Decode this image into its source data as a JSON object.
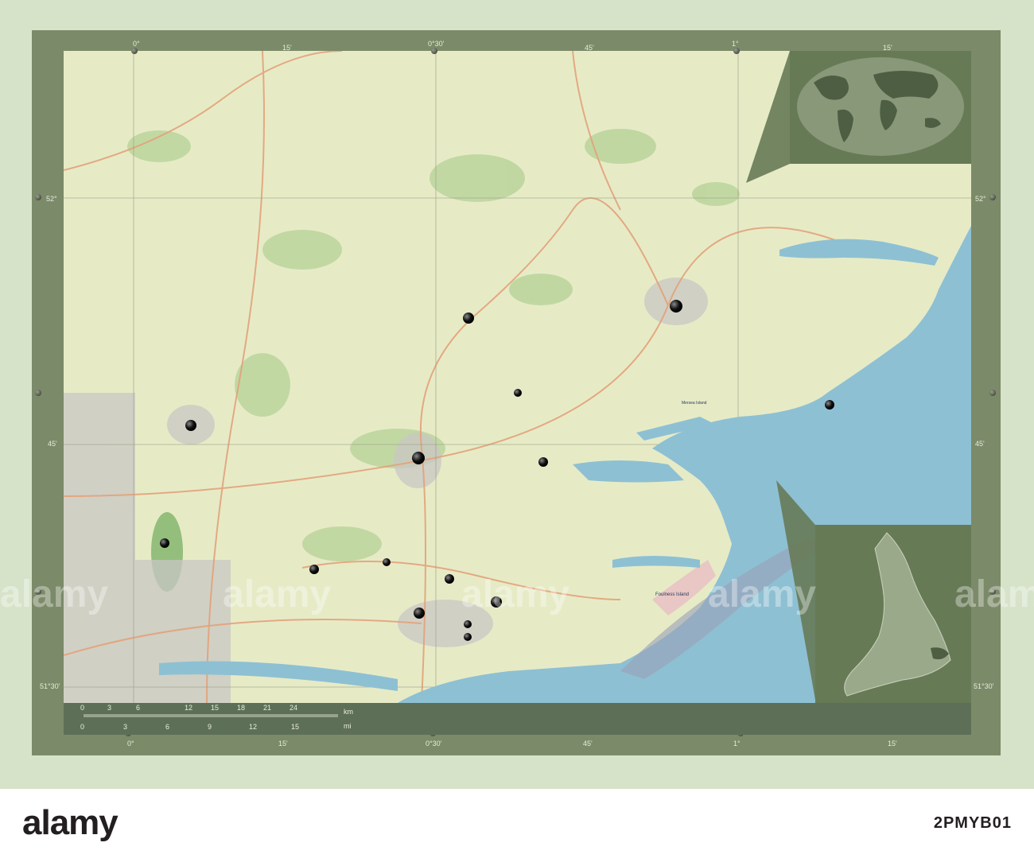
{
  "map": {
    "lon_labels_top": [
      "0°",
      "15'",
      "0°30'",
      "45'",
      "1°",
      "15'"
    ],
    "lon_labels_bottom": [
      "0°",
      "15'",
      "0°30'",
      "45'",
      "1°",
      "15'"
    ],
    "lat_labels": [
      "52°",
      "45'",
      "51°30'"
    ],
    "scale_km_ticks": [
      "0",
      "3",
      "6",
      "12",
      "15",
      "18",
      "21",
      "24"
    ],
    "scale_km_unit": "km",
    "scale_mi_ticks": [
      "0",
      "3",
      "6",
      "9",
      "12",
      "15"
    ],
    "scale_mi_unit": "mi",
    "place_labels": [
      "Mersea Island",
      "Foulness Island"
    ],
    "colors": {
      "sea": "#8ec0d3",
      "land": "#e9edcf",
      "frame": "#7b8a68",
      "inset": "#677a56"
    }
  },
  "watermark": {
    "text": "alamy"
  },
  "footer": {
    "logo": "alamy",
    "stock_id": "2PMYB01"
  }
}
